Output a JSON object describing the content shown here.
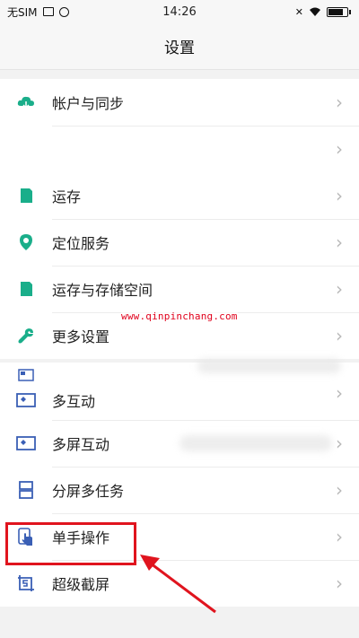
{
  "status_bar": {
    "carrier": "无SIM",
    "time": "14:26",
    "battery_level": 0.85
  },
  "header": {
    "title": "设置"
  },
  "group1": [
    {
      "label": "帐户与同步",
      "icon": "cloud-icon",
      "color": "#1aae8a"
    },
    {
      "label": "",
      "icon": "",
      "color": ""
    }
  ],
  "group2": [
    {
      "label": "运存",
      "icon": "sd-card-icon",
      "color": "#1aae8a"
    },
    {
      "label": "定位服务",
      "icon": "location-pin-icon",
      "color": "#1aae8a"
    },
    {
      "label": "运存与存储空间",
      "icon": "sd-card-icon",
      "color": "#1aae8a"
    },
    {
      "label": "更多设置",
      "icon": "wrench-icon",
      "color": "#1aae8a"
    }
  ],
  "group3": [
    {
      "label": "多互动",
      "icon": "screen-share-icon",
      "color": "#3a5fb5"
    },
    {
      "label": "多屏互动",
      "icon": "screen-share-icon",
      "color": "#3a5fb5"
    },
    {
      "label": "分屏多任务",
      "icon": "split-screen-icon",
      "color": "#3a5fb5"
    },
    {
      "label": "单手操作",
      "icon": "one-hand-icon",
      "color": "#3a5fb5"
    },
    {
      "label": "超级截屏",
      "icon": "screenshot-icon",
      "color": "#3a5fb5"
    }
  ],
  "watermark": "www.qinpinchang.com",
  "colors": {
    "accent_green": "#1aae8a",
    "accent_blue": "#3a5fb5",
    "annotation_red": "#e0141e"
  }
}
